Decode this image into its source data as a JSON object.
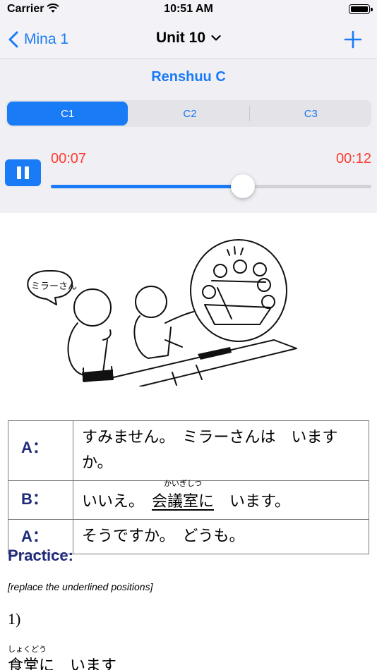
{
  "status_bar": {
    "carrier": "Carrier",
    "time": "10:51 AM"
  },
  "nav": {
    "back_label": "Mina 1",
    "title": "Unit 10"
  },
  "section": {
    "title": "Renshuu C"
  },
  "segments": [
    "C1",
    "C2",
    "C3"
  ],
  "segment_selected": "C1",
  "player": {
    "current_time": "00:07",
    "total_time": "00:12",
    "progress_fraction": 0.6
  },
  "illustration": {
    "speech_bubble_text": "ミラーさん"
  },
  "dialogue": [
    {
      "speaker": "A：",
      "text": "すみません。　ミラーさんは　いますか。"
    },
    {
      "speaker": "B：",
      "text_before": "いいえ。　",
      "furigana": "かいぎしつ",
      "underlined": "会議室に",
      "text_after": "　います。"
    },
    {
      "speaker": "A：",
      "text": "そうですか。　どうも。"
    }
  ],
  "practice": {
    "title": "Practice:",
    "note": "[replace the underlined positions]",
    "exercise_number": "1)",
    "furigana": "しょくどう",
    "exercise_text": "食堂に　います"
  },
  "colors": {
    "accent": "#1a7bf6",
    "time": "#ff3b30",
    "heading": "#1f2a7a"
  }
}
